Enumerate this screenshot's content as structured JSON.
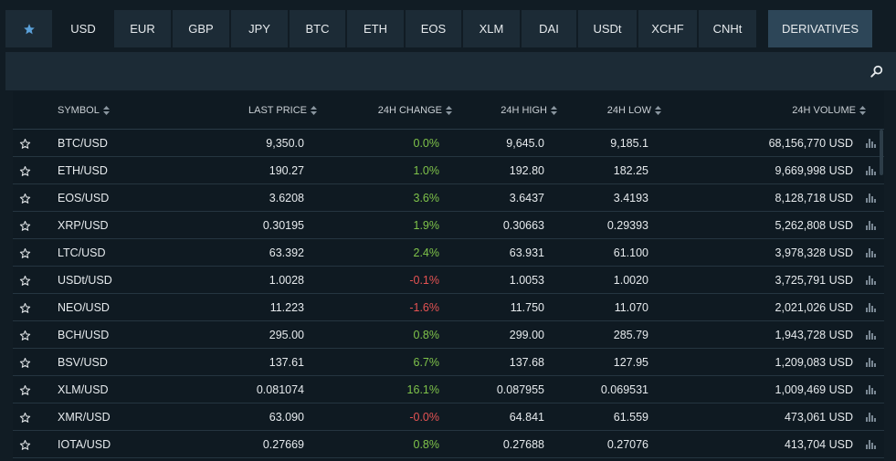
{
  "tabs": [
    {
      "label": "",
      "icon": "star-icon",
      "active": false
    },
    {
      "label": "USD",
      "active": true
    },
    {
      "label": "EUR"
    },
    {
      "label": "GBP"
    },
    {
      "label": "JPY"
    },
    {
      "label": "BTC"
    },
    {
      "label": "ETH"
    },
    {
      "label": "EOS"
    },
    {
      "label": "XLM"
    },
    {
      "label": "DAI"
    },
    {
      "label": "USDt"
    },
    {
      "label": "XCHF"
    },
    {
      "label": "CNHt"
    },
    {
      "label": "DERIVATIVES"
    }
  ],
  "search": {
    "placeholder": "",
    "value": ""
  },
  "table": {
    "headers": {
      "symbol": "SYMBOL",
      "last_price": "LAST PRICE",
      "change": "24H CHANGE",
      "high": "24H HIGH",
      "low": "24H LOW",
      "volume": "24H VOLUME"
    },
    "rows": [
      {
        "symbol": "BTC/USD",
        "last_price": "9,350.0",
        "change": "0.0%",
        "dir": "zero",
        "high": "9,645.0",
        "low": "9,185.1",
        "volume": "68,156,770 USD"
      },
      {
        "symbol": "ETH/USD",
        "last_price": "190.27",
        "change": "1.0%",
        "dir": "pos",
        "high": "192.80",
        "low": "182.25",
        "volume": "9,669,998 USD"
      },
      {
        "symbol": "EOS/USD",
        "last_price": "3.6208",
        "change": "3.6%",
        "dir": "pos",
        "high": "3.6437",
        "low": "3.4193",
        "volume": "8,128,718 USD"
      },
      {
        "symbol": "XRP/USD",
        "last_price": "0.30195",
        "change": "1.9%",
        "dir": "pos",
        "high": "0.30663",
        "low": "0.29393",
        "volume": "5,262,808 USD"
      },
      {
        "symbol": "LTC/USD",
        "last_price": "63.392",
        "change": "2.4%",
        "dir": "pos",
        "high": "63.931",
        "low": "61.100",
        "volume": "3,978,328 USD"
      },
      {
        "symbol": "USDt/USD",
        "last_price": "1.0028",
        "change": "-0.1%",
        "dir": "neg",
        "high": "1.0053",
        "low": "1.0020",
        "volume": "3,725,791 USD"
      },
      {
        "symbol": "NEO/USD",
        "last_price": "11.223",
        "change": "-1.6%",
        "dir": "neg",
        "high": "11.750",
        "low": "11.070",
        "volume": "2,021,026 USD"
      },
      {
        "symbol": "BCH/USD",
        "last_price": "295.00",
        "change": "0.8%",
        "dir": "pos",
        "high": "299.00",
        "low": "285.79",
        "volume": "1,943,728 USD"
      },
      {
        "symbol": "BSV/USD",
        "last_price": "137.61",
        "change": "6.7%",
        "dir": "pos",
        "high": "137.68",
        "low": "127.95",
        "volume": "1,209,083 USD"
      },
      {
        "symbol": "XLM/USD",
        "last_price": "0.081074",
        "change": "16.1%",
        "dir": "pos",
        "high": "0.087955",
        "low": "0.069531",
        "volume": "1,009,469 USD"
      },
      {
        "symbol": "XMR/USD",
        "last_price": "63.090",
        "change": "-0.0%",
        "dir": "neg",
        "high": "64.841",
        "low": "61.559",
        "volume": "473,061 USD"
      },
      {
        "symbol": "IOTA/USD",
        "last_price": "0.27669",
        "change": "0.8%",
        "dir": "pos",
        "high": "0.27688",
        "low": "0.27076",
        "volume": "413,704 USD"
      }
    ]
  },
  "colors": {
    "positive": "#7fc34a",
    "negative": "#e55353",
    "accent": "#5aa0d8"
  }
}
